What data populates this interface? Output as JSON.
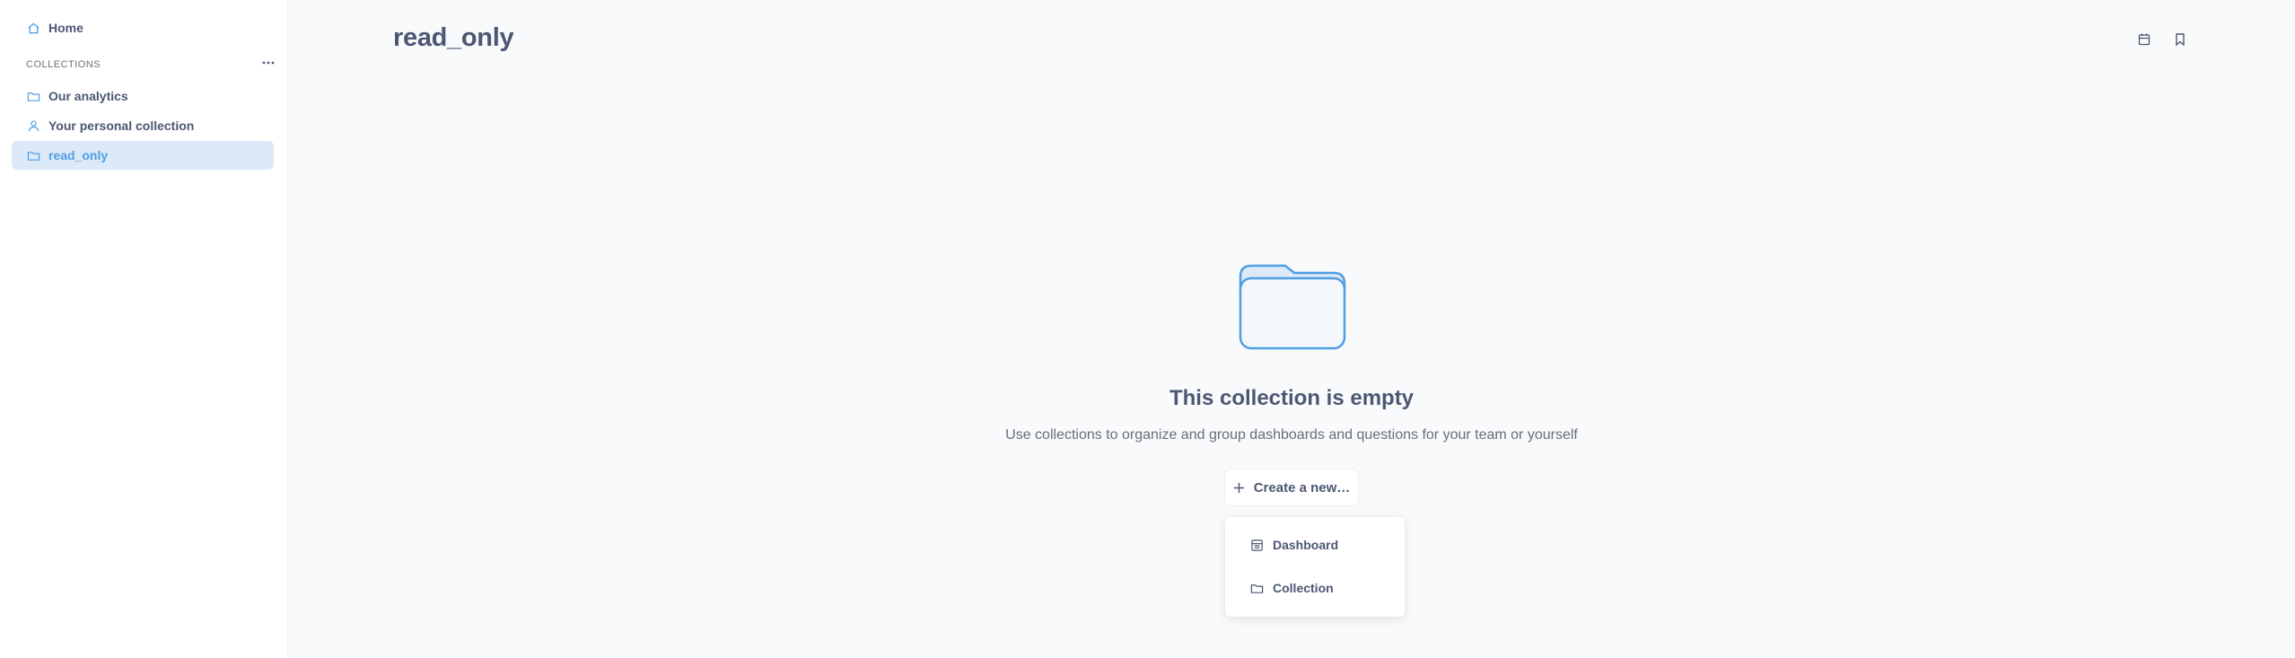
{
  "sidebar": {
    "home_label": "Home",
    "section_title": "COLLECTIONS",
    "items": [
      {
        "label": "Our analytics",
        "icon": "folder-icon"
      },
      {
        "label": "Your personal collection",
        "icon": "person-icon"
      },
      {
        "label": "read_only",
        "icon": "folder-icon",
        "active": true
      }
    ]
  },
  "header": {
    "title": "read_only"
  },
  "empty_state": {
    "title": "This collection is empty",
    "description": "Use collections to organize and group dashboards and questions for your team or yourself",
    "create_button_label": "Create a new…"
  },
  "create_menu": {
    "items": [
      {
        "label": "Dashboard",
        "icon": "dashboard-icon"
      },
      {
        "label": "Collection",
        "icon": "folder-icon"
      }
    ]
  },
  "colors": {
    "accent": "#509ee3",
    "active_bg": "#dbe9f8",
    "text": "#4c5773",
    "muted_text": "#696e7b"
  }
}
